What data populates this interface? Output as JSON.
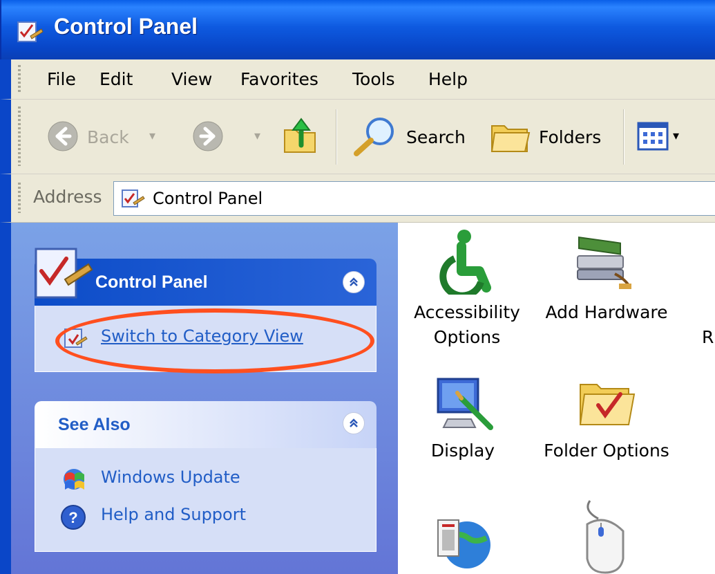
{
  "window": {
    "title": "Control Panel"
  },
  "menu": [
    "File",
    "Edit",
    "View",
    "Favorites",
    "Tools",
    "Help"
  ],
  "toolbar": {
    "back_label": "Back",
    "search_label": "Search",
    "folders_label": "Folders"
  },
  "address": {
    "label": "Address",
    "value": "Control Panel"
  },
  "taskpane": {
    "control_panel": {
      "title": "Control Panel",
      "switch_link": "Switch to Category View"
    },
    "see_also": {
      "title": "See Also",
      "links": [
        "Windows Update",
        "Help and Support"
      ]
    }
  },
  "items": [
    {
      "line1": "Accessibility",
      "line2": "Options",
      "icon": "accessibility-icon"
    },
    {
      "line1": "Add Hardware",
      "line2": "",
      "icon": "add-hardware-icon"
    },
    {
      "line1": "R",
      "line2": "",
      "icon": "cut-off-item"
    },
    {
      "line1": "Display",
      "line2": "",
      "icon": "display-icon"
    },
    {
      "line1": "Folder Options",
      "line2": "",
      "icon": "folder-options-icon"
    },
    {
      "line1": "",
      "line2": "",
      "icon": "network-icon"
    },
    {
      "line1": "",
      "line2": "",
      "icon": "mouse-icon"
    }
  ],
  "colors": {
    "title_bar": "#0a5fe8",
    "task_pane": "#7ba2e7",
    "highlight_ellipse": "#ff4f1f",
    "link": "#215dc6"
  }
}
